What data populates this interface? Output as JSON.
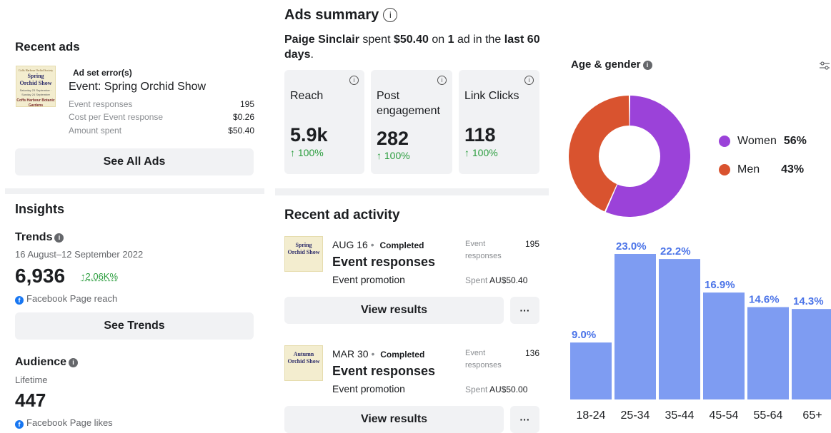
{
  "recent_ads": {
    "title": "Recent ads",
    "ad": {
      "thumb": {
        "line1": "Coffs Harbour Orchid Society",
        "name1": "Spring",
        "name2": "Orchid Show",
        "details": "Saturday 23 September · Sunday 24 September",
        "venue": "Coffs Harbour Botanic Gardens"
      },
      "error": "Ad set error(s)",
      "title": "Event: Spring Orchid Show",
      "stats": [
        {
          "label": "Event responses",
          "value": "195"
        },
        {
          "label": "Cost per Event response",
          "value": "$0.26"
        },
        {
          "label": "Amount spent",
          "value": "$50.40"
        }
      ]
    },
    "see_all": "See All Ads"
  },
  "insights": {
    "title": "Insights",
    "trends": {
      "title": "Trends",
      "date_range": "16 August–12 September 2022",
      "value": "6,936",
      "change": "↑2.06K%",
      "metric": "Facebook Page reach",
      "button": "See Trends"
    },
    "audience": {
      "title": "Audience",
      "period": "Lifetime",
      "value": "447",
      "metric": "Facebook Page likes"
    }
  },
  "ads_summary": {
    "title": "Ads summary",
    "info": "i",
    "sentence": {
      "name": "Paige Sinclair",
      "t1": " spent ",
      "amount": "$50.40",
      "t2": " on ",
      "count": "1",
      "t3": " ad in the ",
      "period": "last 60 days",
      "t4": "."
    },
    "cards": [
      {
        "label": "Reach",
        "value": "5.9k",
        "change": "↑ 100%"
      },
      {
        "label": "Post engagement",
        "value": "282",
        "change": "↑ 100%"
      },
      {
        "label": "Link Clicks",
        "value": "118",
        "change": "↑ 100%"
      }
    ]
  },
  "recent_activity": {
    "title": "Recent ad activity",
    "items": [
      {
        "thumb_name1": "Spring",
        "thumb_name2": "Orchid Show",
        "date": "AUG 16",
        "sep": "•",
        "status": "Completed",
        "title": "Event responses",
        "subtitle": "Event promotion",
        "stat_label1": "Event",
        "stat_label2": "responses",
        "stat_value": "195",
        "spent_label": "Spent",
        "spent_value": "AU$50.40",
        "button": "View results",
        "more": "···"
      },
      {
        "thumb_name1": "Autumn",
        "thumb_name2": "Orchid Show",
        "date": "MAR 30",
        "sep": "•",
        "status": "Completed",
        "title": "Event responses",
        "subtitle": "Event promotion",
        "stat_label1": "Event",
        "stat_label2": "responses",
        "stat_value": "136",
        "spent_label": "Spent",
        "spent_value": "AU$50.00",
        "button": "View results",
        "more": "···"
      }
    ]
  },
  "age_gender": {
    "title": "Age & gender",
    "legend": [
      {
        "label": "Women",
        "pct": "56%",
        "color": "#9b42d9"
      },
      {
        "label": "Men",
        "pct": "43%",
        "color": "#d9532f"
      }
    ]
  },
  "chart_data": [
    {
      "type": "pie",
      "style": "donut",
      "categories": [
        "Women",
        "Men"
      ],
      "values": [
        56,
        43
      ],
      "colors": [
        "#9b42d9",
        "#d9532f"
      ]
    },
    {
      "type": "bar",
      "categories": [
        "18-24",
        "25-34",
        "35-44",
        "45-54",
        "55-64",
        "65+"
      ],
      "values": [
        9.0,
        23.0,
        22.2,
        16.9,
        14.6,
        14.3
      ],
      "labels": [
        "9.0%",
        "23.0%",
        "22.2%",
        "16.9%",
        "14.6%",
        "14.3%"
      ],
      "ylim": [
        0,
        23.0
      ],
      "bar_color": "#7e9cf2",
      "label_color": "#4a73e8"
    }
  ]
}
